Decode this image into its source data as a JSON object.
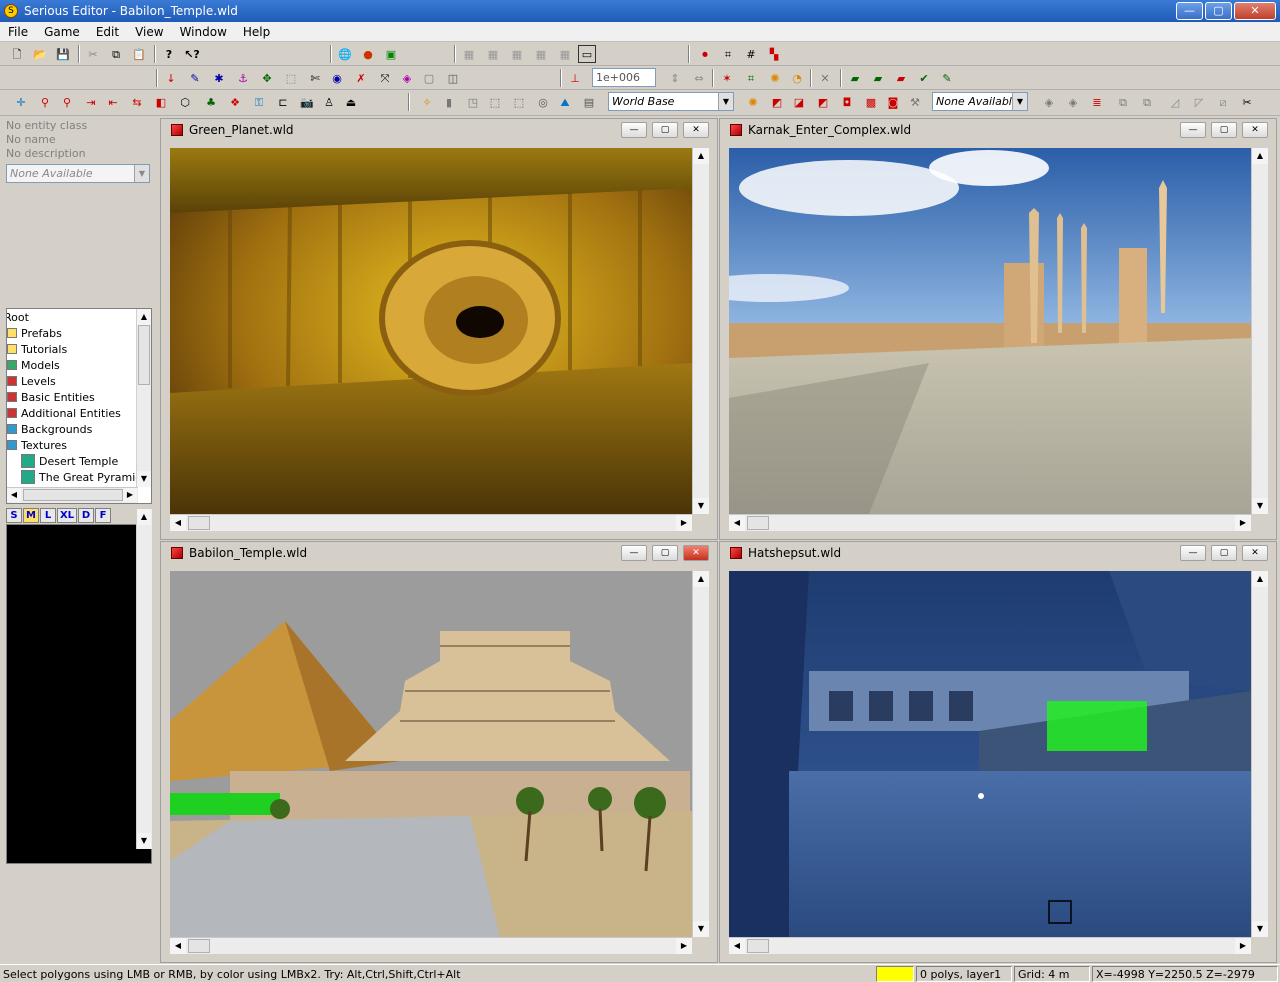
{
  "window": {
    "title": "Serious Editor - Babilon_Temple.wld",
    "minimize": "—",
    "maximize": "▢",
    "close": "✕"
  },
  "menu": [
    "File",
    "Game",
    "Edit",
    "View",
    "Window",
    "Help"
  ],
  "toolbar": {
    "exponent_field": "1e+006",
    "world_base_select": "World Base",
    "none_available_select": "None Available"
  },
  "entity_panel": {
    "entity_class": "No entity class",
    "name": "No name",
    "description": "No description",
    "none_available": "None Available"
  },
  "tree": {
    "root": "Root",
    "items": [
      "Prefabs",
      "Tutorials",
      "Models",
      "Levels",
      "Basic Entities",
      "Additional Entities",
      "Backgrounds",
      "Textures"
    ],
    "sub_items": [
      "Desert Temple",
      "The Great Pyramid"
    ]
  },
  "lod_buttons": [
    "S",
    "M",
    "L",
    "XL",
    "D",
    "F"
  ],
  "views": [
    {
      "title": "Green_Planet.wld"
    },
    {
      "title": "Karnak_Enter_Complex.wld"
    },
    {
      "title": "Babilon_Temple.wld"
    },
    {
      "title": "Hatshepsut.wld"
    }
  ],
  "status": {
    "message": "Select polygons using LMB or RMB, by color using LMBx2. Try: Alt,Ctrl,Shift,Ctrl+Alt",
    "color_swatch": "#ffff00",
    "polys": "0 polys, layer1",
    "grid": "Grid: 4 m",
    "coords": "X=-4998 Y=2250.5 Z=-2979"
  }
}
